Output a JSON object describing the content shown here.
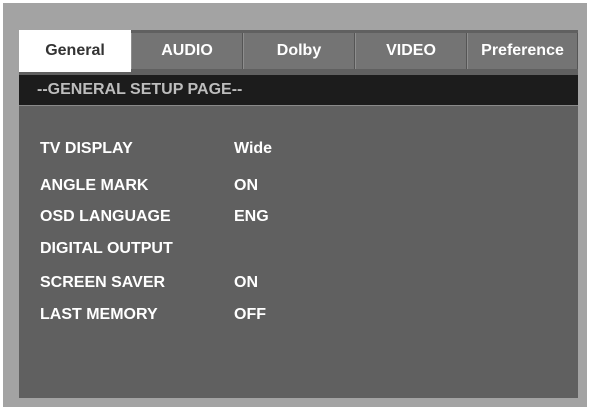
{
  "tabs": [
    {
      "label": "General",
      "active": true
    },
    {
      "label": "AUDIO",
      "active": false
    },
    {
      "label": "Dolby",
      "active": false
    },
    {
      "label": "VIDEO",
      "active": false
    },
    {
      "label": "Preference",
      "active": false
    }
  ],
  "page": {
    "title": "--GENERAL SETUP PAGE--"
  },
  "settings": [
    {
      "label": "TV DISPLAY",
      "value": "Wide"
    },
    {
      "label": "ANGLE MARK",
      "value": "ON"
    },
    {
      "label": "OSD LANGUAGE",
      "value": "ENG"
    },
    {
      "label": "DIGITAL OUTPUT",
      "value": ""
    },
    {
      "label": "SCREEN SAVER",
      "value": "ON"
    },
    {
      "label": "LAST MEMORY",
      "value": "OFF"
    }
  ],
  "colors": {
    "frame": "#a3a3a3",
    "screen": "#606060",
    "tab_inactive": "#747474",
    "tab_active": "#ffffff",
    "header_bar": "#1c1c1c",
    "header_text": "#bdbdbd",
    "text": "#ffffff"
  }
}
